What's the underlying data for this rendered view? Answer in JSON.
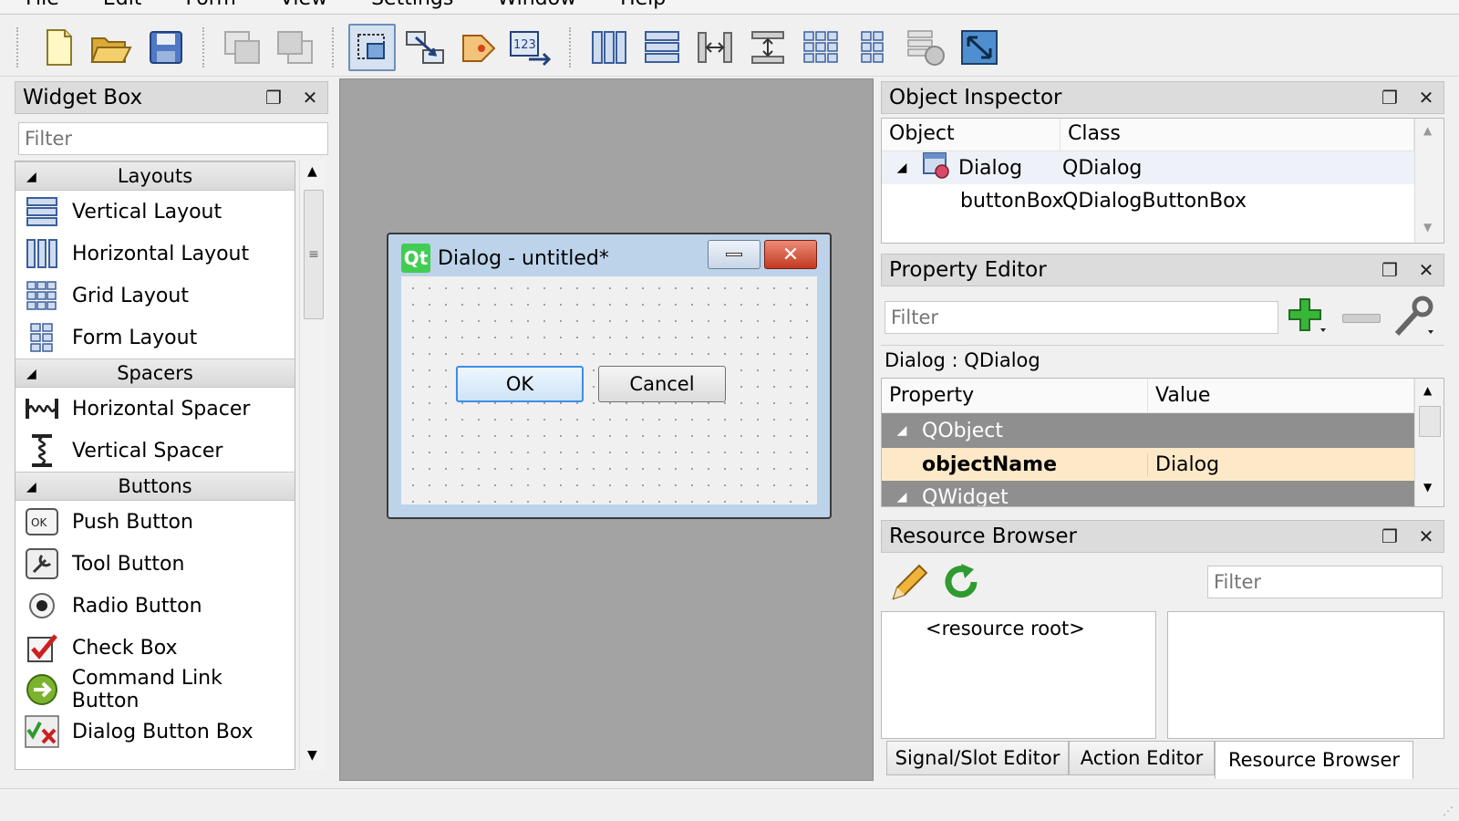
{
  "menubar": [
    "File",
    "Edit",
    "Form",
    "View",
    "Settings",
    "Window",
    "Help"
  ],
  "widget_box": {
    "title": "Widget Box",
    "filter_placeholder": "Filter",
    "categories": [
      {
        "label": "Layouts",
        "items": [
          "Vertical Layout",
          "Horizontal Layout",
          "Grid Layout",
          "Form Layout"
        ]
      },
      {
        "label": "Spacers",
        "items": [
          "Horizontal Spacer",
          "Vertical Spacer"
        ]
      },
      {
        "label": "Buttons",
        "items": [
          "Push Button",
          "Tool Button",
          "Radio Button",
          "Check Box",
          "Command Link Button",
          "Dialog Button Box"
        ]
      }
    ]
  },
  "form": {
    "title": "Dialog - untitled*",
    "ok_label": "OK",
    "cancel_label": "Cancel"
  },
  "object_inspector": {
    "title": "Object Inspector",
    "col_object": "Object",
    "col_class": "Class",
    "rows": [
      {
        "object": "Dialog",
        "class": "QDialog"
      },
      {
        "object": "buttonBox",
        "class": "QDialogButtonBox"
      }
    ]
  },
  "property_editor": {
    "title": "Property Editor",
    "filter_placeholder": "Filter",
    "context": "Dialog : QDialog",
    "col_property": "Property",
    "col_value": "Value",
    "group": "QObject",
    "prop_name": "objectName",
    "prop_value": "Dialog",
    "next_group": "QWidget"
  },
  "resource_browser": {
    "title": "Resource Browser",
    "filter_placeholder": "Filter",
    "root": "<resource root>"
  },
  "bottom_tabs": [
    "Signal/Slot Editor",
    "Action Editor",
    "Resource Browser"
  ],
  "colors": {
    "accent": "#3d8ee6",
    "qt_green": "#41cd52",
    "group_bg": "#8f8f8f",
    "selected_row": "#fde9c8"
  }
}
